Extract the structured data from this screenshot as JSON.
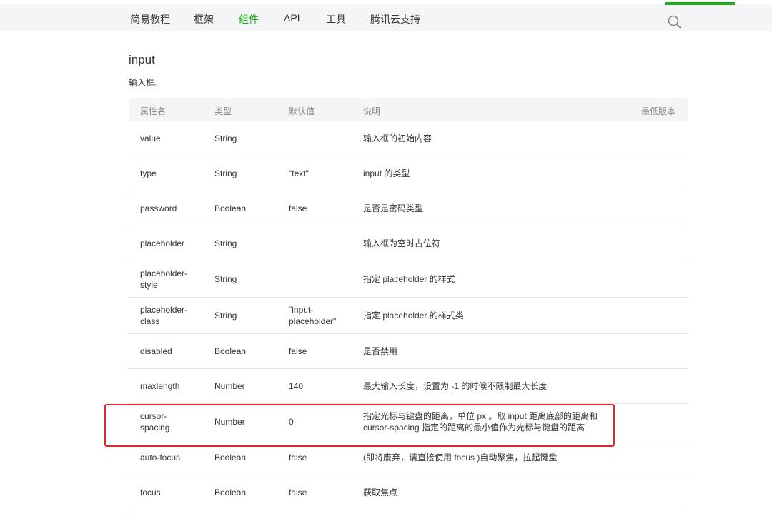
{
  "nav": {
    "items": [
      {
        "label": "简易教程",
        "active": false
      },
      {
        "label": "框架",
        "active": false
      },
      {
        "label": "组件",
        "active": true
      },
      {
        "label": "API",
        "active": false
      },
      {
        "label": "工具",
        "active": false
      },
      {
        "label": "腾讯云支持",
        "active": false
      }
    ],
    "search_icon": "search-icon",
    "accent_color": "#1aad19"
  },
  "page": {
    "title": "input",
    "description": "输入框。"
  },
  "table": {
    "headers": {
      "name": "属性名",
      "type": "类型",
      "default": "默认值",
      "desc": "说明",
      "version": "最低版本"
    },
    "rows": [
      {
        "name": "value",
        "type": "String",
        "default": "",
        "desc": "输入框的初始内容"
      },
      {
        "name": "type",
        "type": "String",
        "default": "\"text\"",
        "desc": "input 的类型"
      },
      {
        "name": "password",
        "type": "Boolean",
        "default": "false",
        "desc": "是否是密码类型"
      },
      {
        "name": "placeholder",
        "type": "String",
        "default": "",
        "desc": "输入框为空时占位符"
      },
      {
        "name": "placeholder-style",
        "type": "String",
        "default": "",
        "desc": "指定 placeholder 的样式"
      },
      {
        "name": "placeholder-class",
        "type": "String",
        "default": "\"input-placeholder\"",
        "desc": "指定 placeholder 的样式类"
      },
      {
        "name": "disabled",
        "type": "Boolean",
        "default": "false",
        "desc": "是否禁用"
      },
      {
        "name": "maxlength",
        "type": "Number",
        "default": "140",
        "desc": "最大输入长度，设置为 -1 的时候不限制最大长度"
      },
      {
        "name": "cursor-spacing",
        "type": "Number",
        "default": "0",
        "desc": "指定光标与键盘的距离，单位 px 。取 input 距离底部的距离和 cursor-spacing 指定的距离的最小值作为光标与键盘的距离",
        "highlighted": true
      },
      {
        "name": "auto-focus",
        "type": "Boolean",
        "default": "false",
        "desc": "(即将废弃，请直接使用 focus )自动聚焦，拉起键盘"
      },
      {
        "name": "focus",
        "type": "Boolean",
        "default": "false",
        "desc": "获取焦点"
      }
    ]
  },
  "highlight_color": "#e0292f"
}
